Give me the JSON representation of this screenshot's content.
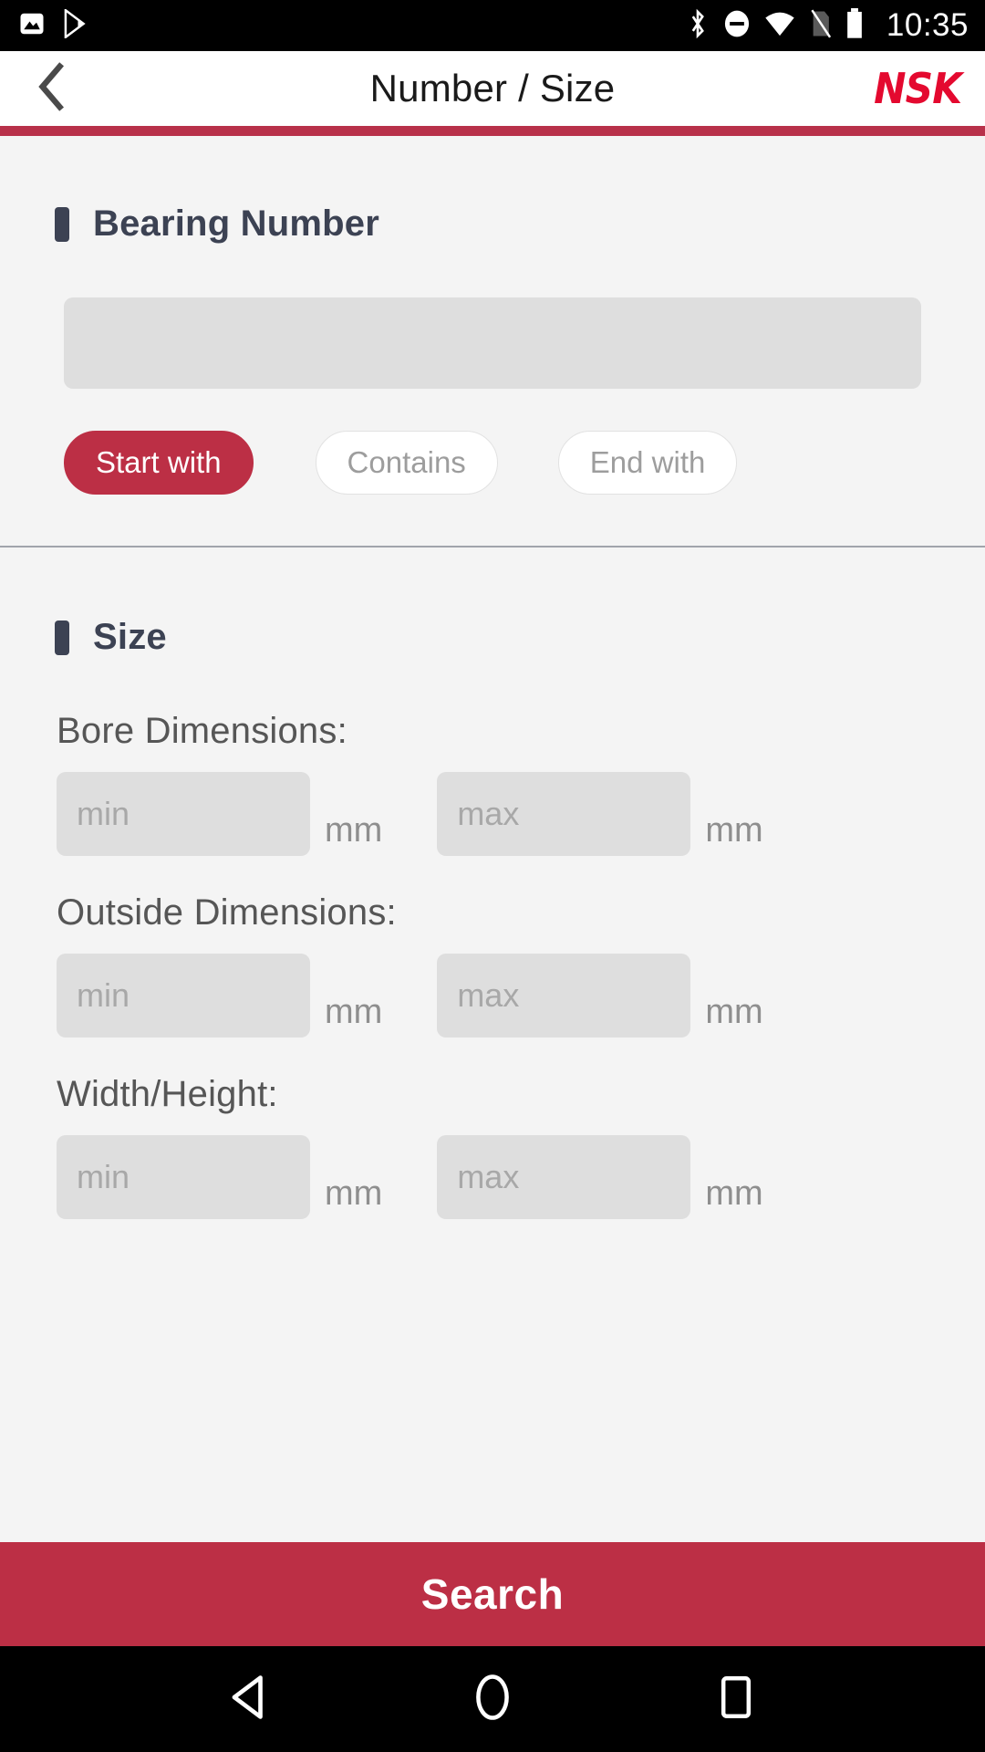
{
  "status_bar": {
    "time": "10:35",
    "left_icons": [
      "photo-icon",
      "play-store-icon"
    ],
    "right_icons": [
      "bluetooth-icon",
      "do-not-disturb-icon",
      "wifi-icon",
      "no-sim-icon",
      "battery-icon"
    ]
  },
  "app_bar": {
    "back_icon": "back-chevron-icon",
    "title": "Number / Size",
    "logo": "NSK"
  },
  "bearing_section": {
    "title": "Bearing Number",
    "input_value": "",
    "input_placeholder": "",
    "match_modes": [
      {
        "label": "Start with",
        "active": true
      },
      {
        "label": "Contains",
        "active": false
      },
      {
        "label": "End with",
        "active": false
      }
    ]
  },
  "size_section": {
    "title": "Size",
    "unit": "mm",
    "min_placeholder": "min",
    "max_placeholder": "max",
    "rows": [
      {
        "label": "Bore Dimensions:",
        "min_value": "",
        "max_value": ""
      },
      {
        "label": "Outside Dimensions:",
        "min_value": "",
        "max_value": ""
      },
      {
        "label": "Width/Height:",
        "min_value": "",
        "max_value": ""
      }
    ]
  },
  "footer": {
    "search_label": "Search"
  },
  "nav_bar": {
    "back": "back-triangle-icon",
    "home": "home-circle-icon",
    "recents": "recents-square-icon"
  },
  "colors": {
    "brand_red": "#bc2f45",
    "logo_red": "#e4092f",
    "heading_navy": "#3c4253",
    "page_bg": "#f4f4f4",
    "field_grey": "#dedede"
  }
}
